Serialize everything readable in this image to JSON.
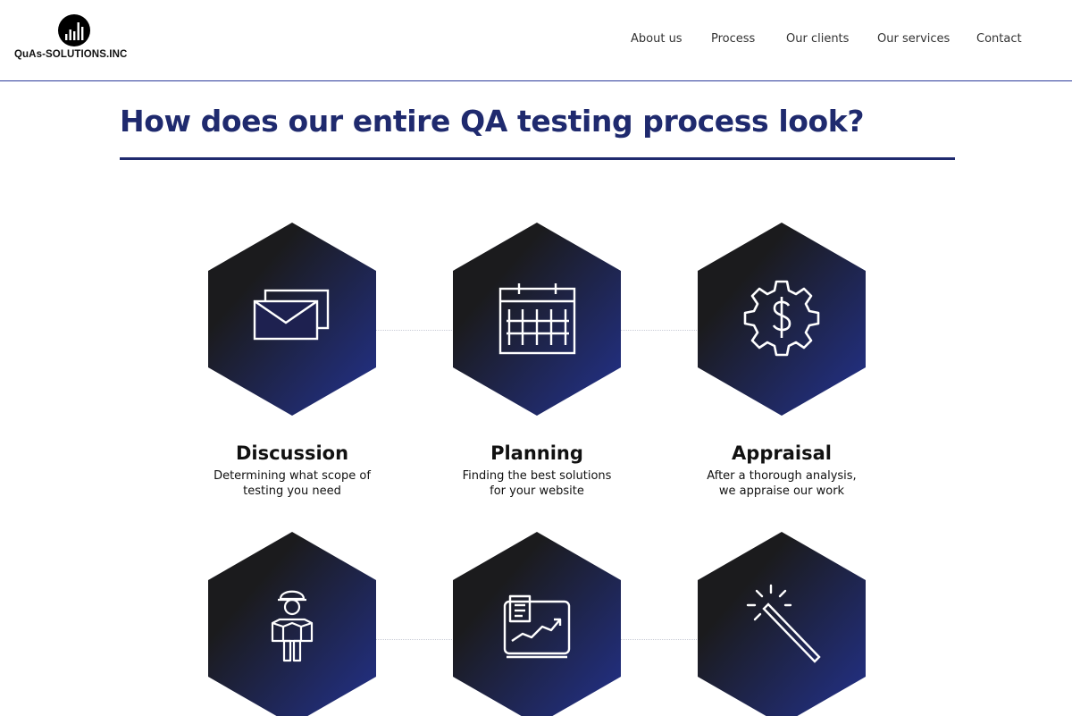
{
  "brand": {
    "name": "QuAs-SOLUTIONS.INC",
    "logo_icon": "bar-chart-icon"
  },
  "nav": [
    {
      "label": "About us"
    },
    {
      "label": "Process"
    },
    {
      "label": "Our clients"
    },
    {
      "label": "Our services"
    },
    {
      "label": "Contact"
    }
  ],
  "page_title": "How does our entire QA testing process look?",
  "colors": {
    "accent": "#1f2a6e",
    "hex_dark": "#1b1b1d",
    "hex_blue": "#23328f",
    "divider": "#2b3a9a"
  },
  "steps": [
    {
      "title": "Discussion",
      "desc_line1": "Determining what scope of",
      "desc_line2": "testing you need",
      "icon": "envelope-icon"
    },
    {
      "title": "Planning",
      "desc_line1": "Finding the best solutions",
      "desc_line2": "for your website",
      "icon": "calendar-icon"
    },
    {
      "title": "Appraisal",
      "desc_line1": "After a thorough analysis,",
      "desc_line2": "we appraise our work",
      "icon": "dollar-gear-icon"
    },
    {
      "icon": "engineer-icon"
    },
    {
      "icon": "report-chart-icon"
    },
    {
      "icon": "magic-wand-icon"
    }
  ]
}
